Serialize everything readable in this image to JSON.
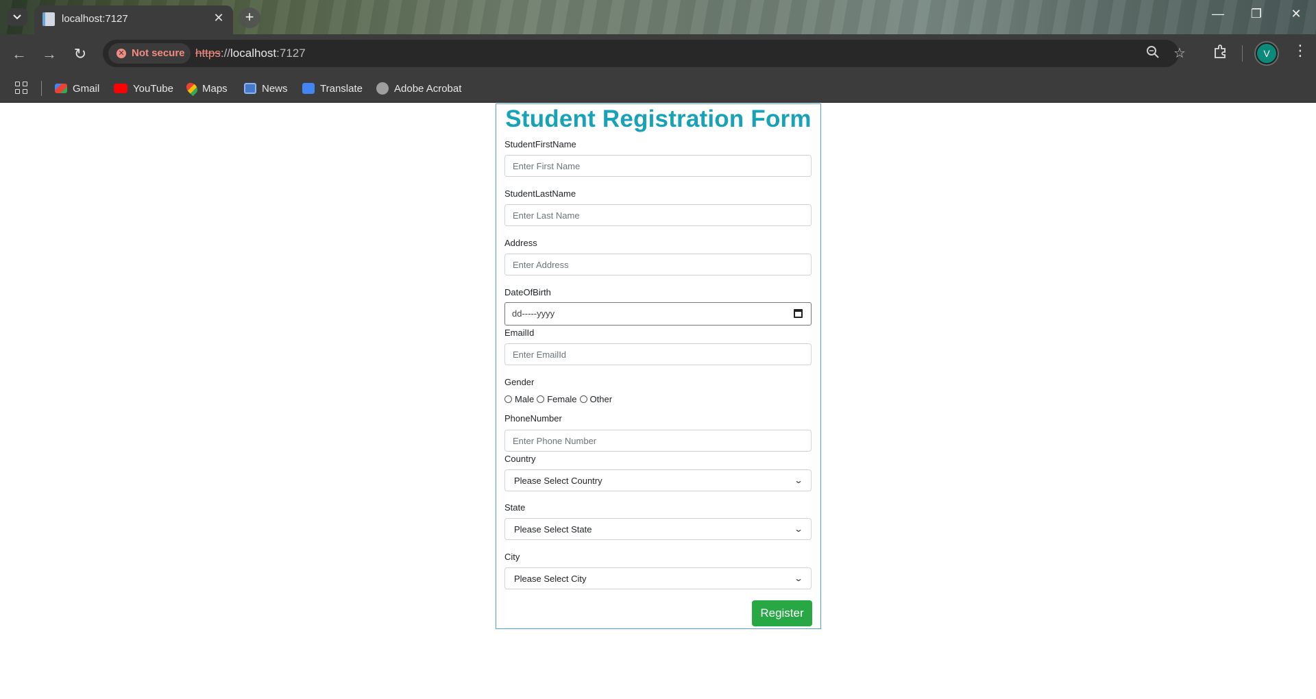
{
  "browser": {
    "tab_title": "localhost:7127",
    "new_tab_symbol": "+",
    "security_label": "Not secure",
    "url_scheme": "https",
    "url_separator": "://",
    "url_host": "localhost",
    "url_port": ":7127",
    "profile_initial": "V",
    "bookmarks": [
      "Gmail",
      "YouTube",
      "Maps",
      "News",
      "Translate",
      "Adobe Acrobat"
    ],
    "colors": {
      "chrome": "#3c3c3c",
      "omnibox": "#282828",
      "warning": "#f28b82",
      "avatar": "#0b8a7a"
    }
  },
  "form": {
    "title": "Student Registration Form",
    "first_name": {
      "label": "StudentFirstName",
      "placeholder": "Enter First Name"
    },
    "last_name": {
      "label": "StudentLastName",
      "placeholder": "Enter Last Name"
    },
    "address": {
      "label": "Address",
      "placeholder": "Enter Address"
    },
    "dob": {
      "label": "DateOfBirth",
      "value": "dd-----yyyy"
    },
    "email": {
      "label": "EmailId",
      "placeholder": "Enter EmailId"
    },
    "gender": {
      "label": "Gender",
      "options": [
        "Male",
        "Female",
        "Other"
      ]
    },
    "phone": {
      "label": "PhoneNumber",
      "placeholder": "Enter Phone Number"
    },
    "country": {
      "label": "Country",
      "selected": "Please Select Country"
    },
    "state": {
      "label": "State",
      "selected": "Please Select State"
    },
    "city": {
      "label": "City",
      "selected": "Please Select City"
    },
    "register_label": "Register",
    "colors": {
      "title": "#17a2b8",
      "border": "#4da3d6",
      "button": "#28a745"
    }
  }
}
